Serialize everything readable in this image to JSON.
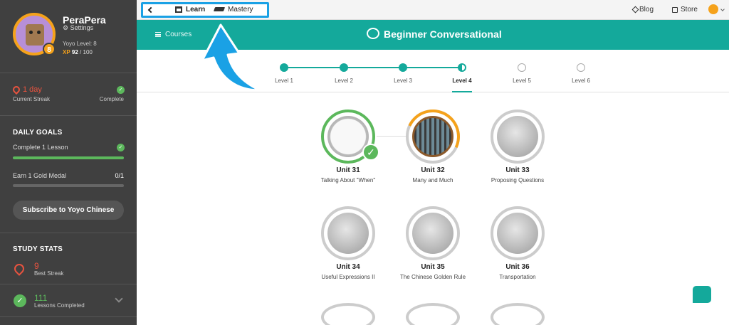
{
  "sidebar": {
    "profile": {
      "username": "PeraPera",
      "settings_label": "Settings",
      "avatar_badge": "8",
      "level_label": "Yoyo Level: 8",
      "xp_label": "XP",
      "xp_value": "92",
      "xp_max": "/ 100"
    },
    "streak": {
      "value": "1 day",
      "label": "Current Streak",
      "status": "Complete"
    },
    "daily_goals": {
      "title": "DAILY GOALS",
      "goals": [
        {
          "label": "Complete 1 Lesson",
          "progress": 1.0,
          "count": ""
        },
        {
          "label": "Earn 1 Gold Medal",
          "progress": 0.0,
          "count": "0/1"
        }
      ]
    },
    "subscribe_label": "Subscribe to Yoyo Chinese",
    "study_stats": {
      "title": "STUDY STATS",
      "best_streak_value": "9",
      "best_streak_label": "Best Streak",
      "lessons_value": "111",
      "lessons_label": "Lessons Completed"
    }
  },
  "topbar": {
    "learn_label": "Learn",
    "mastery_label": "Mastery",
    "blog_label": "Blog",
    "store_label": "Store"
  },
  "header": {
    "courses_label": "Courses",
    "course_title": "Beginner Conversational"
  },
  "levels": [
    {
      "label": "Level 1",
      "state": "done"
    },
    {
      "label": "Level 2",
      "state": "done"
    },
    {
      "label": "Level 3",
      "state": "done"
    },
    {
      "label": "Level 4",
      "state": "current"
    },
    {
      "label": "Level 5",
      "state": "todo"
    },
    {
      "label": "Level 6",
      "state": "todo"
    }
  ],
  "units": [
    {
      "title": "Unit 31",
      "subtitle": "Talking About \"When\"",
      "status": "complete"
    },
    {
      "title": "Unit 32",
      "subtitle": "Many and Much",
      "status": "in-progress"
    },
    {
      "title": "Unit 33",
      "subtitle": "Proposing Questions",
      "status": "locked"
    },
    {
      "title": "Unit 34",
      "subtitle": "Useful Expressions II",
      "status": "locked"
    },
    {
      "title": "Unit 35",
      "subtitle": "The Chinese Golden Rule",
      "status": "locked"
    },
    {
      "title": "Unit 36",
      "subtitle": "Transportation",
      "status": "locked"
    }
  ],
  "icons": {
    "back": "chevron-left-icon",
    "learn": "book-icon",
    "mastery": "graduation-cap-icon",
    "blog": "pen-icon",
    "store": "bag-icon",
    "course": "chat-bubble-icon",
    "courses_menu": "hamburger-icon",
    "chat": "chat-icon"
  },
  "colors": {
    "sidebar_bg": "#404040",
    "teal": "#14a99b",
    "accent_orange": "#f5a21b",
    "success_green": "#5cb85c",
    "streak_red": "#e8533f",
    "highlight_blue": "#1aa1e5"
  }
}
